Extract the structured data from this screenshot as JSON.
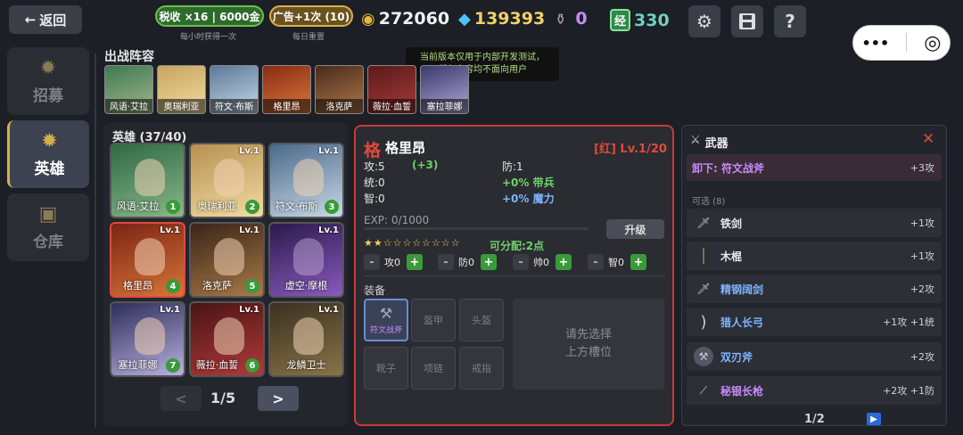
{
  "header": {
    "back_label": "返回",
    "tax_pill": "税收 ×16 | 6000金",
    "tax_sub": "每小时获得一次",
    "ad_pill": "广告+1次 (10)",
    "ad_sub": "每日重置",
    "gold": "272060",
    "diamond": "139393",
    "potion": "0",
    "exp_badge": "经",
    "exp_value": "330",
    "settings_icon": "gear-icon",
    "save_icon": "save-icon",
    "help_label": "?"
  },
  "capsule": {
    "menu_label": "•••",
    "close_label": "◎"
  },
  "tooltip": {
    "line1": "当前版本仅用于内部开发测试，",
    "line2": "所有内容均不面向用户"
  },
  "nav": [
    {
      "label": "招募",
      "icon": "emblem-icon"
    },
    {
      "label": "英雄",
      "icon": "emblem-icon",
      "active": true
    },
    {
      "label": "仓库",
      "icon": "chest-icon"
    }
  ],
  "team": {
    "title": "出战阵容",
    "members": [
      "风语·艾拉",
      "奥瑞利亚",
      "符文·布斯",
      "格里昂",
      "洛克萨",
      "薇拉·血誓",
      "塞拉菲娜"
    ]
  },
  "heroes": {
    "title": "英雄 (37/40)",
    "list": [
      {
        "name": "风语·艾拉",
        "lv": "Lv.1",
        "num": "1"
      },
      {
        "name": "奥瑞利亚",
        "lv": "Lv.1",
        "num": "2"
      },
      {
        "name": "符文·布斯",
        "lv": "Lv.1",
        "num": "3"
      },
      {
        "name": "格里昂",
        "lv": "Lv.1",
        "num": "4"
      },
      {
        "name": "洛克萨",
        "lv": "Lv.1",
        "num": "5"
      },
      {
        "name": "虚空·摩根",
        "lv": "Lv.1",
        "num": ""
      },
      {
        "name": "塞拉菲娜",
        "lv": "Lv.1",
        "num": "7"
      },
      {
        "name": "薇拉·血誓",
        "lv": "Lv.1",
        "num": "6"
      },
      {
        "name": "龙鳞卫士",
        "lv": "Lv.1",
        "num": ""
      }
    ],
    "pager": {
      "prev": "<",
      "page": "1/5",
      "next": ">"
    }
  },
  "detail": {
    "badge": "格",
    "name": "格里昂",
    "rarity_level": "[红] Lv.1/20",
    "atk_label": "攻:5",
    "atk_bonus": "(+3)",
    "def_label": "防:1",
    "cmd_label": "统:0",
    "cmd_bonus": "+0% 带兵",
    "int_label": "智:0",
    "int_bonus": "+0% 魔力",
    "exp": "EXP: 0/1000",
    "upgrade_label": "升级",
    "stars": "★★☆☆☆☆☆☆☆☆",
    "points": "可分配:2点",
    "alloc": [
      {
        "minus": "-",
        "label": "攻0",
        "plus": "+"
      },
      {
        "minus": "-",
        "label": "防0",
        "plus": "+"
      },
      {
        "minus": "-",
        "label": "帅0",
        "plus": "+"
      },
      {
        "minus": "-",
        "label": "智0",
        "plus": "+"
      }
    ],
    "equip_title": "装备",
    "slots": [
      "符文战斧",
      "盔甲",
      "头盔",
      "靴子",
      "项链",
      "戒指"
    ],
    "hint_line1": "请先选择",
    "hint_line2": "上方槽位"
  },
  "weapons": {
    "title": "武器",
    "unequip_label": "卸下: 符文战斧",
    "unequip_stat": "+3攻",
    "available": "可选 (8)",
    "items": [
      {
        "name": "铁剑",
        "stat": "+1攻",
        "color": "#e8e8e8",
        "icon": "sword-icon"
      },
      {
        "name": "木棍",
        "stat": "+1攻",
        "color": "#e8e8e8",
        "icon": "staff-icon"
      },
      {
        "name": "精钢阔剑",
        "stat": "+2攻",
        "color": "#7fb2ff",
        "icon": "broadsword-icon"
      },
      {
        "name": "猎人长弓",
        "stat": "+1攻 +1统",
        "color": "#7fb2ff",
        "icon": "bow-icon"
      },
      {
        "name": "双刃斧",
        "stat": "+2攻",
        "color": "#7fb2ff",
        "icon": "double-axe-icon"
      },
      {
        "name": "秘银长枪",
        "stat": "+2攻 +1防",
        "color": "#c58bff",
        "icon": "spear-icon"
      }
    ],
    "page": "1/2",
    "next": "▶"
  },
  "colors": {
    "accent_red": "#c73a3a",
    "gold": "#f1d06a",
    "green": "#6fd06a",
    "purple": "#c58bff",
    "blue": "#7fb2ff"
  }
}
